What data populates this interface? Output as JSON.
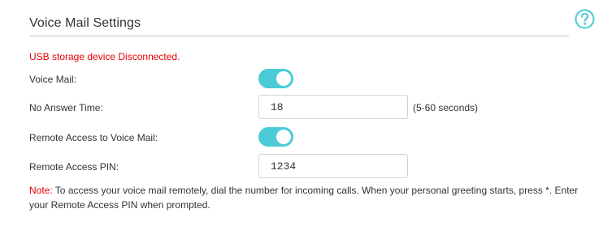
{
  "header": {
    "title": "Voice Mail Settings",
    "help_icon": "question-circle-icon"
  },
  "status": {
    "message": "USB storage device Disconnected.",
    "color": "#e60000"
  },
  "form": {
    "voice_mail": {
      "label": "Voice Mail:",
      "enabled": true
    },
    "no_answer_time": {
      "label": "No Answer Time:",
      "value": "18",
      "unit_hint": "(5-60 seconds)"
    },
    "remote_access": {
      "label": "Remote Access to Voice Mail:",
      "enabled": true
    },
    "remote_pin": {
      "label": "Remote Access PIN:",
      "value": "1234"
    }
  },
  "note": {
    "label": "Note:",
    "text": " To access your voice mail remotely, dial the number for incoming calls. When your personal greeting starts, press *. Enter your Remote Access PIN when prompted."
  },
  "colors": {
    "accent": "#4acbd6",
    "error": "#e60000",
    "text": "#333333",
    "rule": "#c9c9c9"
  }
}
